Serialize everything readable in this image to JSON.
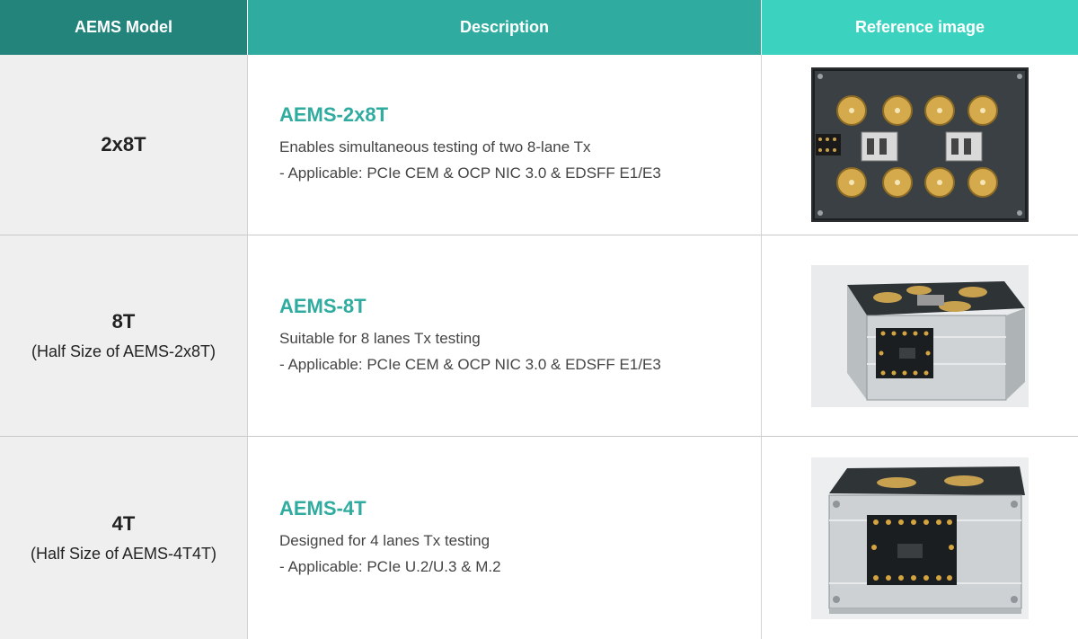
{
  "header": {
    "col1": "AEMS Model",
    "col2": "Description",
    "col3": "Reference image"
  },
  "rows": [
    {
      "model": "2x8T",
      "model_sub": "",
      "title": "AEMS-2x8T",
      "line1": "Enables simultaneous testing of two 8-lane Tx",
      "line2": "- Applicable: PCIe CEM & OCP NIC 3.0 & EDSFF E1/E3"
    },
    {
      "model": "8T",
      "model_sub": "(Half Size of AEMS-2x8T)",
      "title": "AEMS-8T",
      "line1": "Suitable for 8 lanes Tx testing",
      "line2": "- Applicable: PCIe CEM & OCP NIC 3.0 & EDSFF E1/E3"
    },
    {
      "model": "4T",
      "model_sub": "(Half Size of AEMS-4T4T)",
      "title": "AEMS-4T",
      "line1": "Designed for 4 lanes Tx testing",
      "line2": "- Applicable: PCIe U.2/U.3 & M.2"
    }
  ],
  "colors": {
    "header_dark": "#23847b",
    "header_mid": "#2fac9f",
    "header_light": "#3cd2c0",
    "accent_title": "#2fac9f"
  }
}
